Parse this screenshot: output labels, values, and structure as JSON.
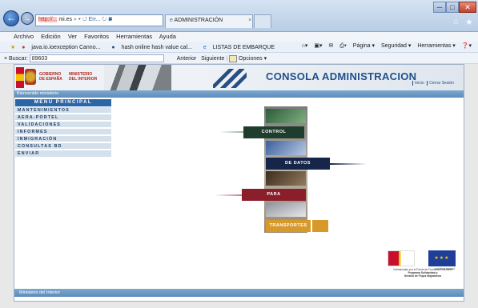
{
  "browser": {
    "address_hidden": "http://...",
    "address_suffix": "mi.es",
    "address_controls": "⌕ ▾ ↺ Err... ↻ ✖",
    "tab_active": "ADMINISTRACIÓN",
    "window_controls": [
      "─",
      "□",
      "✕"
    ],
    "top_icons": [
      "⌂",
      "★",
      "⚙"
    ],
    "menu": [
      "Archivo",
      "Edición",
      "Ver",
      "Favoritos",
      "Herramientas",
      "Ayuda"
    ],
    "favorites": [
      "java.io.ioexception Canno...",
      "hash online hash value cal...",
      "LISTAS DE EMBARQUE"
    ],
    "command_bar": [
      "Página ▾",
      "Seguridad ▾",
      "Herramientas ▾",
      "❓▾"
    ],
    "find": {
      "label": "Buscar:",
      "value": "89603",
      "prev": "Anterior",
      "next": "Siguiente",
      "options": "Opciones ▾"
    }
  },
  "header": {
    "gov_line1": "GOBIERNO",
    "gov_line2": "DE ESPAÑA",
    "ministry_line1": "MINISTERIO",
    "ministry_line2": "DEL INTERIOR",
    "title": "CONSOLA ADMINISTRACION",
    "links": [
      "Inicio",
      "Cerrar Sesión"
    ],
    "welcome": "Bienvenido ministerio"
  },
  "menu": {
    "heading": "MENÚ PRINCIPAL",
    "items": [
      "MANTENIMIENTOS",
      "AERA-PORTEL",
      "VALIDACIONES",
      "INFORMES",
      "INMIGRACIÓN",
      "CONSULTAS BD",
      "ENVIAR"
    ]
  },
  "graphic": {
    "blocks": [
      "CONTROL",
      "DE DATOS",
      "PARA",
      "TRANSPORTES"
    ]
  },
  "eu": {
    "flag_label": "UNIÓN EUROPEA",
    "text_lines": [
      "Cofinanciado por el Fondo de Fronteras Exteriores",
      "Programa Solidaridad y",
      "Gestión de Flujos Migratorios"
    ]
  },
  "footer": {
    "text": "Ministerio del Interior"
  },
  "colors": {
    "brand_blue": "#1f4f8a",
    "menu_bg": "#d4e0ec",
    "control_green": "#1f3d2c",
    "datos_navy": "#15264a",
    "para_red": "#8a1f2b",
    "transportes_gold": "#d79a2a"
  }
}
